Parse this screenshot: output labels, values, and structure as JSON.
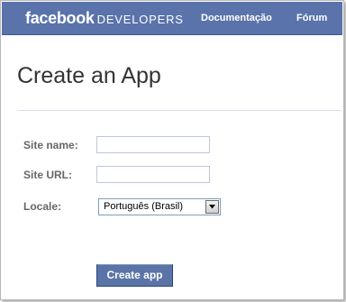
{
  "header": {
    "logo_brand": "facebook",
    "logo_suffix": "DEVELOPERS",
    "nav": [
      {
        "label": "Documentação"
      },
      {
        "label": "Fórum"
      }
    ]
  },
  "page": {
    "title": "Create an App"
  },
  "form": {
    "site_name": {
      "label": "Site name:",
      "value": ""
    },
    "site_url": {
      "label": "Site URL:",
      "value": ""
    },
    "locale": {
      "label": "Locale:",
      "value": "Português (Brasil)"
    },
    "submit_label": "Create app"
  },
  "colors": {
    "header_bg": "#5a73ab",
    "button_bg": "#5b74a8",
    "label_text": "#666666"
  },
  "icons": {
    "locale_dropdown": "chevron-down-icon"
  }
}
